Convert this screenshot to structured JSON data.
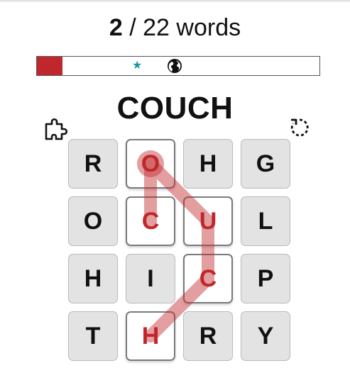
{
  "header": {
    "found_count": "2",
    "separator": " / ",
    "total_words": "22 words"
  },
  "progress": {
    "fraction": 0.091,
    "fill_color": "#c0272d",
    "star_icon": "star-icon",
    "star_glyph": "★",
    "star_color": "#1a9aa0",
    "globe_icon": "globe-icon"
  },
  "current_word": "COUCH",
  "toolbar": {
    "hint_icon": "puzzle-piece-icon",
    "restart_icon": "dashed-refresh-icon"
  },
  "board": {
    "rows": [
      [
        "R",
        "O",
        "H",
        "G"
      ],
      [
        "O",
        "C",
        "U",
        "L"
      ],
      [
        "H",
        "I",
        "C",
        "P"
      ],
      [
        "T",
        "H",
        "R",
        "Y"
      ]
    ],
    "selected_path": [
      [
        0,
        1
      ],
      [
        1,
        1
      ],
      [
        0,
        1
      ],
      [
        1,
        2
      ],
      [
        2,
        2
      ],
      [
        3,
        1
      ]
    ],
    "path_color": "#c0272d",
    "selected_letter_color": "#c0272d"
  }
}
